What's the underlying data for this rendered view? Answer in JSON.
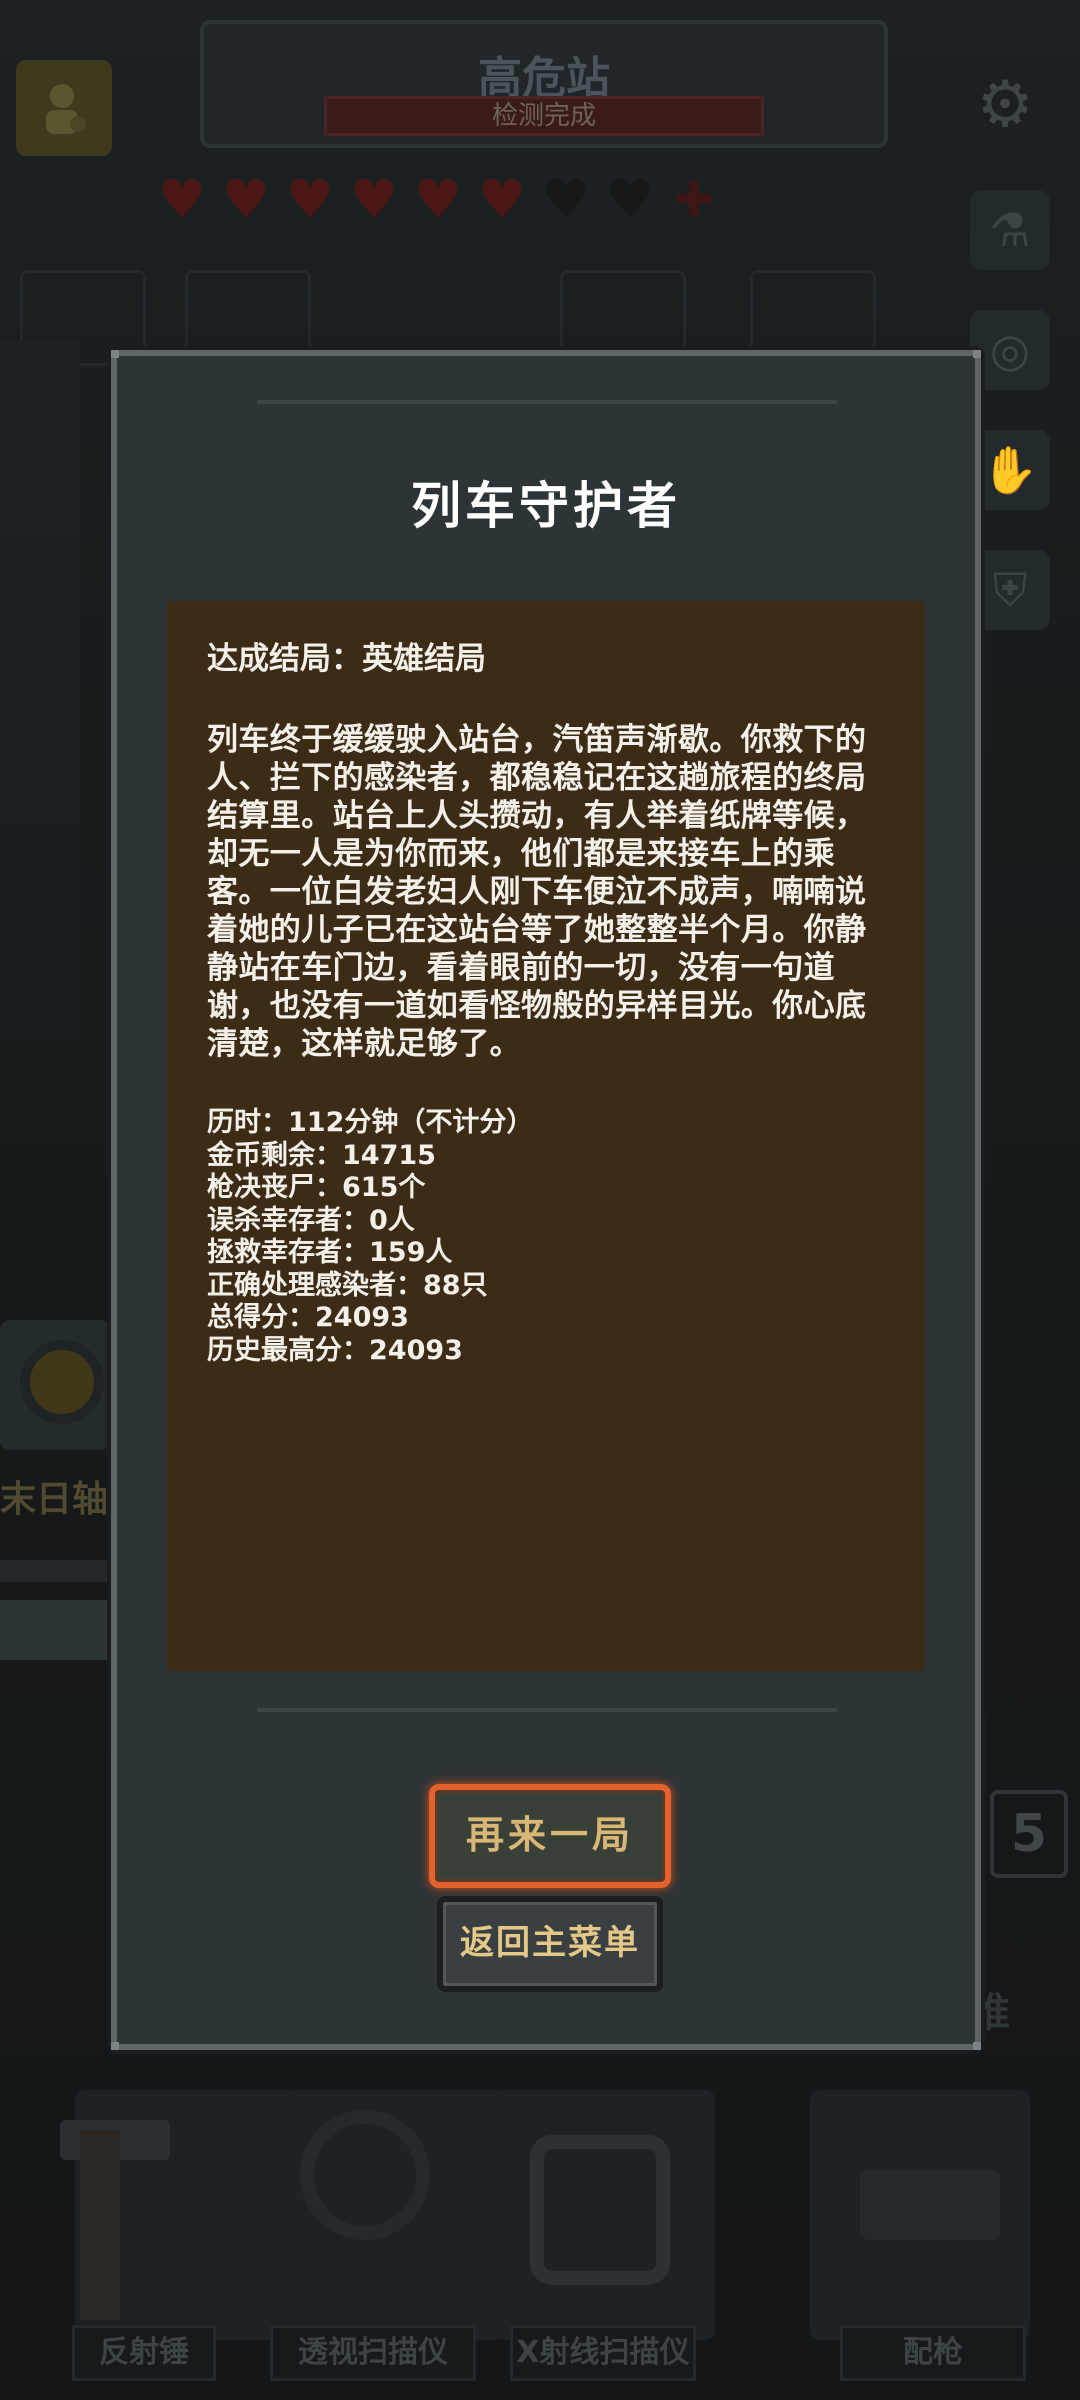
{
  "background": {
    "station_name": "高危站",
    "station_status": "检测完成",
    "hearts": {
      "filled": 6,
      "empty": 2
    },
    "left_item_label": "末日轴",
    "right_badge": "5",
    "right_text": "推",
    "tools": [
      "反射锤",
      "透视扫描仪",
      "X射线扫描仪",
      "配枪"
    ]
  },
  "modal": {
    "title": "列车守护者",
    "ending": "达成结局：英雄结局",
    "story": "列车终于缓缓驶入站台，汽笛声渐歇。你救下的人、拦下的感染者，都稳稳记在这趟旅程的终局结算里。站台上人头攒动，有人举着纸牌等候，却无一人是为你而来，他们都是来接车上的乘客。一位白发老妇人刚下车便泣不成声，喃喃说着她的儿子已在这站台等了她整整半个月。你静静站在车门边，看着眼前的一切，没有一句道谢，也没有一道如看怪物般的异样目光。你心底清楚，这样就足够了。",
    "stats": [
      "历时：112分钟（不计分）",
      "金币剩余：14715",
      "枪决丧尸：615个",
      "误杀幸存者：0人",
      "拯救幸存者：159人",
      "正确处理感染者：88只",
      "总得分：24093",
      "历史最高分：24093"
    ],
    "replay_label": "再来一局",
    "menu_label": "返回主菜单"
  },
  "colors": {
    "modal_bg": "#2d3437",
    "panel_bg": "#3c2b15",
    "replay_border": "#e3612b",
    "button_text": "#d8b675"
  }
}
